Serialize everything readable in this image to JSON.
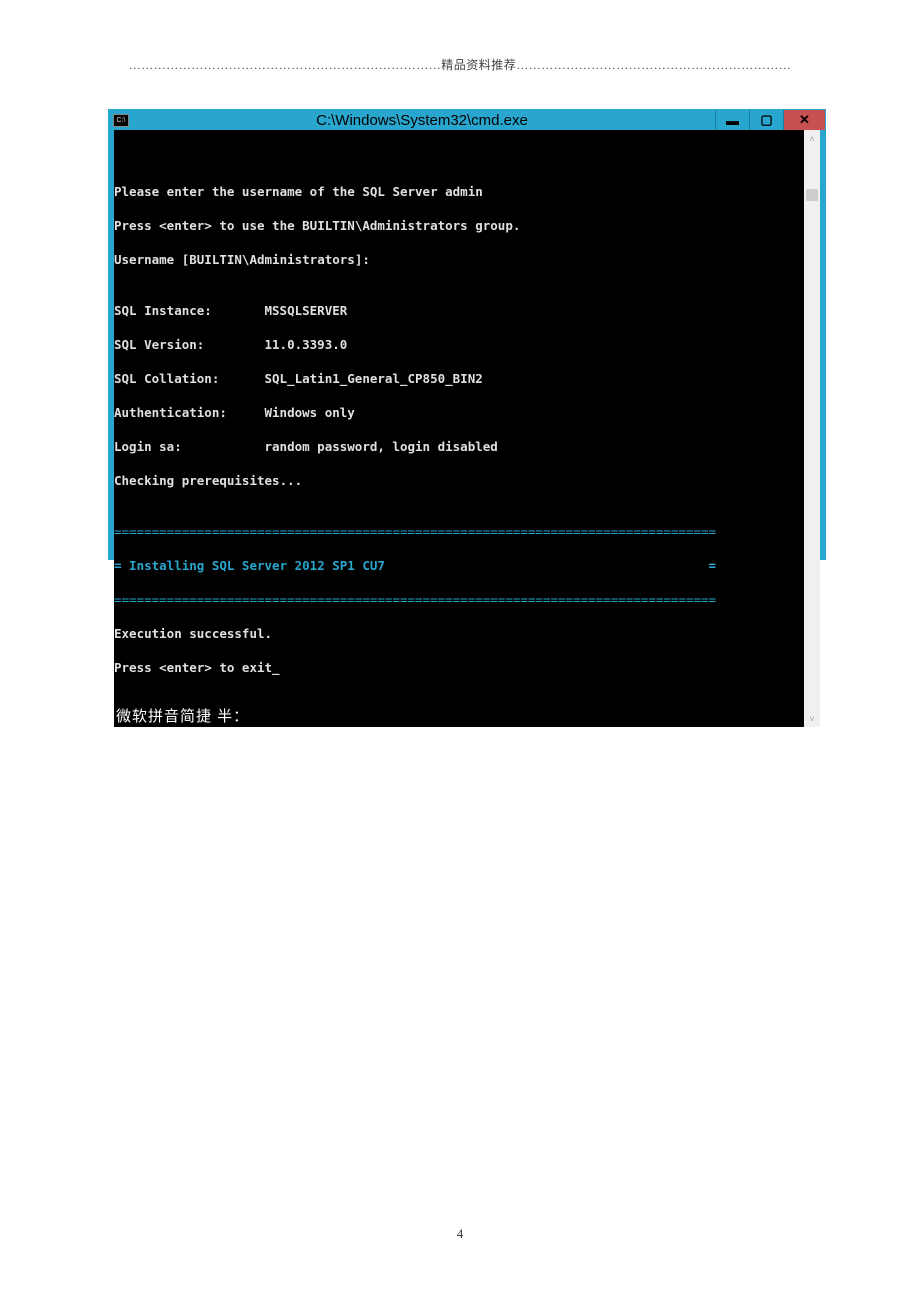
{
  "doc": {
    "header_dots_left": "…………………………………………………………………",
    "header_text": "精品资料推荐",
    "header_dots_right": "…………………………………………………………",
    "page_number": "4"
  },
  "window": {
    "icon_text": "C:\\",
    "title": "C:\\Windows\\System32\\cmd.exe",
    "buttons": {
      "minimize": "▬",
      "maximize": "▢",
      "close": "✕"
    }
  },
  "terminal": {
    "blank": "",
    "lines_intro": [
      "Please enter the username of the SQL Server admin",
      "Press <enter> to use the BUILTIN\\Administrators group.",
      "Username [BUILTIN\\Administrators]:"
    ],
    "props": [
      {
        "key": "SQL Instance:",
        "value": "MSSQLSERVER"
      },
      {
        "key": "SQL Version:",
        "value": "11.0.3393.0"
      },
      {
        "key": "SQL Collation:",
        "value": "SQL_Latin1_General_CP850_BIN2"
      },
      {
        "key": "Authentication:",
        "value": "Windows only"
      },
      {
        "key": "Login sa:",
        "value": "random password, login disabled"
      }
    ],
    "checking": "Checking prerequisites...",
    "sep": "================================================================================",
    "install_line": "= Installing SQL Server 2012 SP1 CU7                                           =",
    "lines_end": [
      "Execution successful.",
      "Press <enter> to exit_"
    ],
    "ime": "微软拼音简捷 半："
  },
  "scroll": {
    "up": "˄",
    "down": "˅"
  }
}
